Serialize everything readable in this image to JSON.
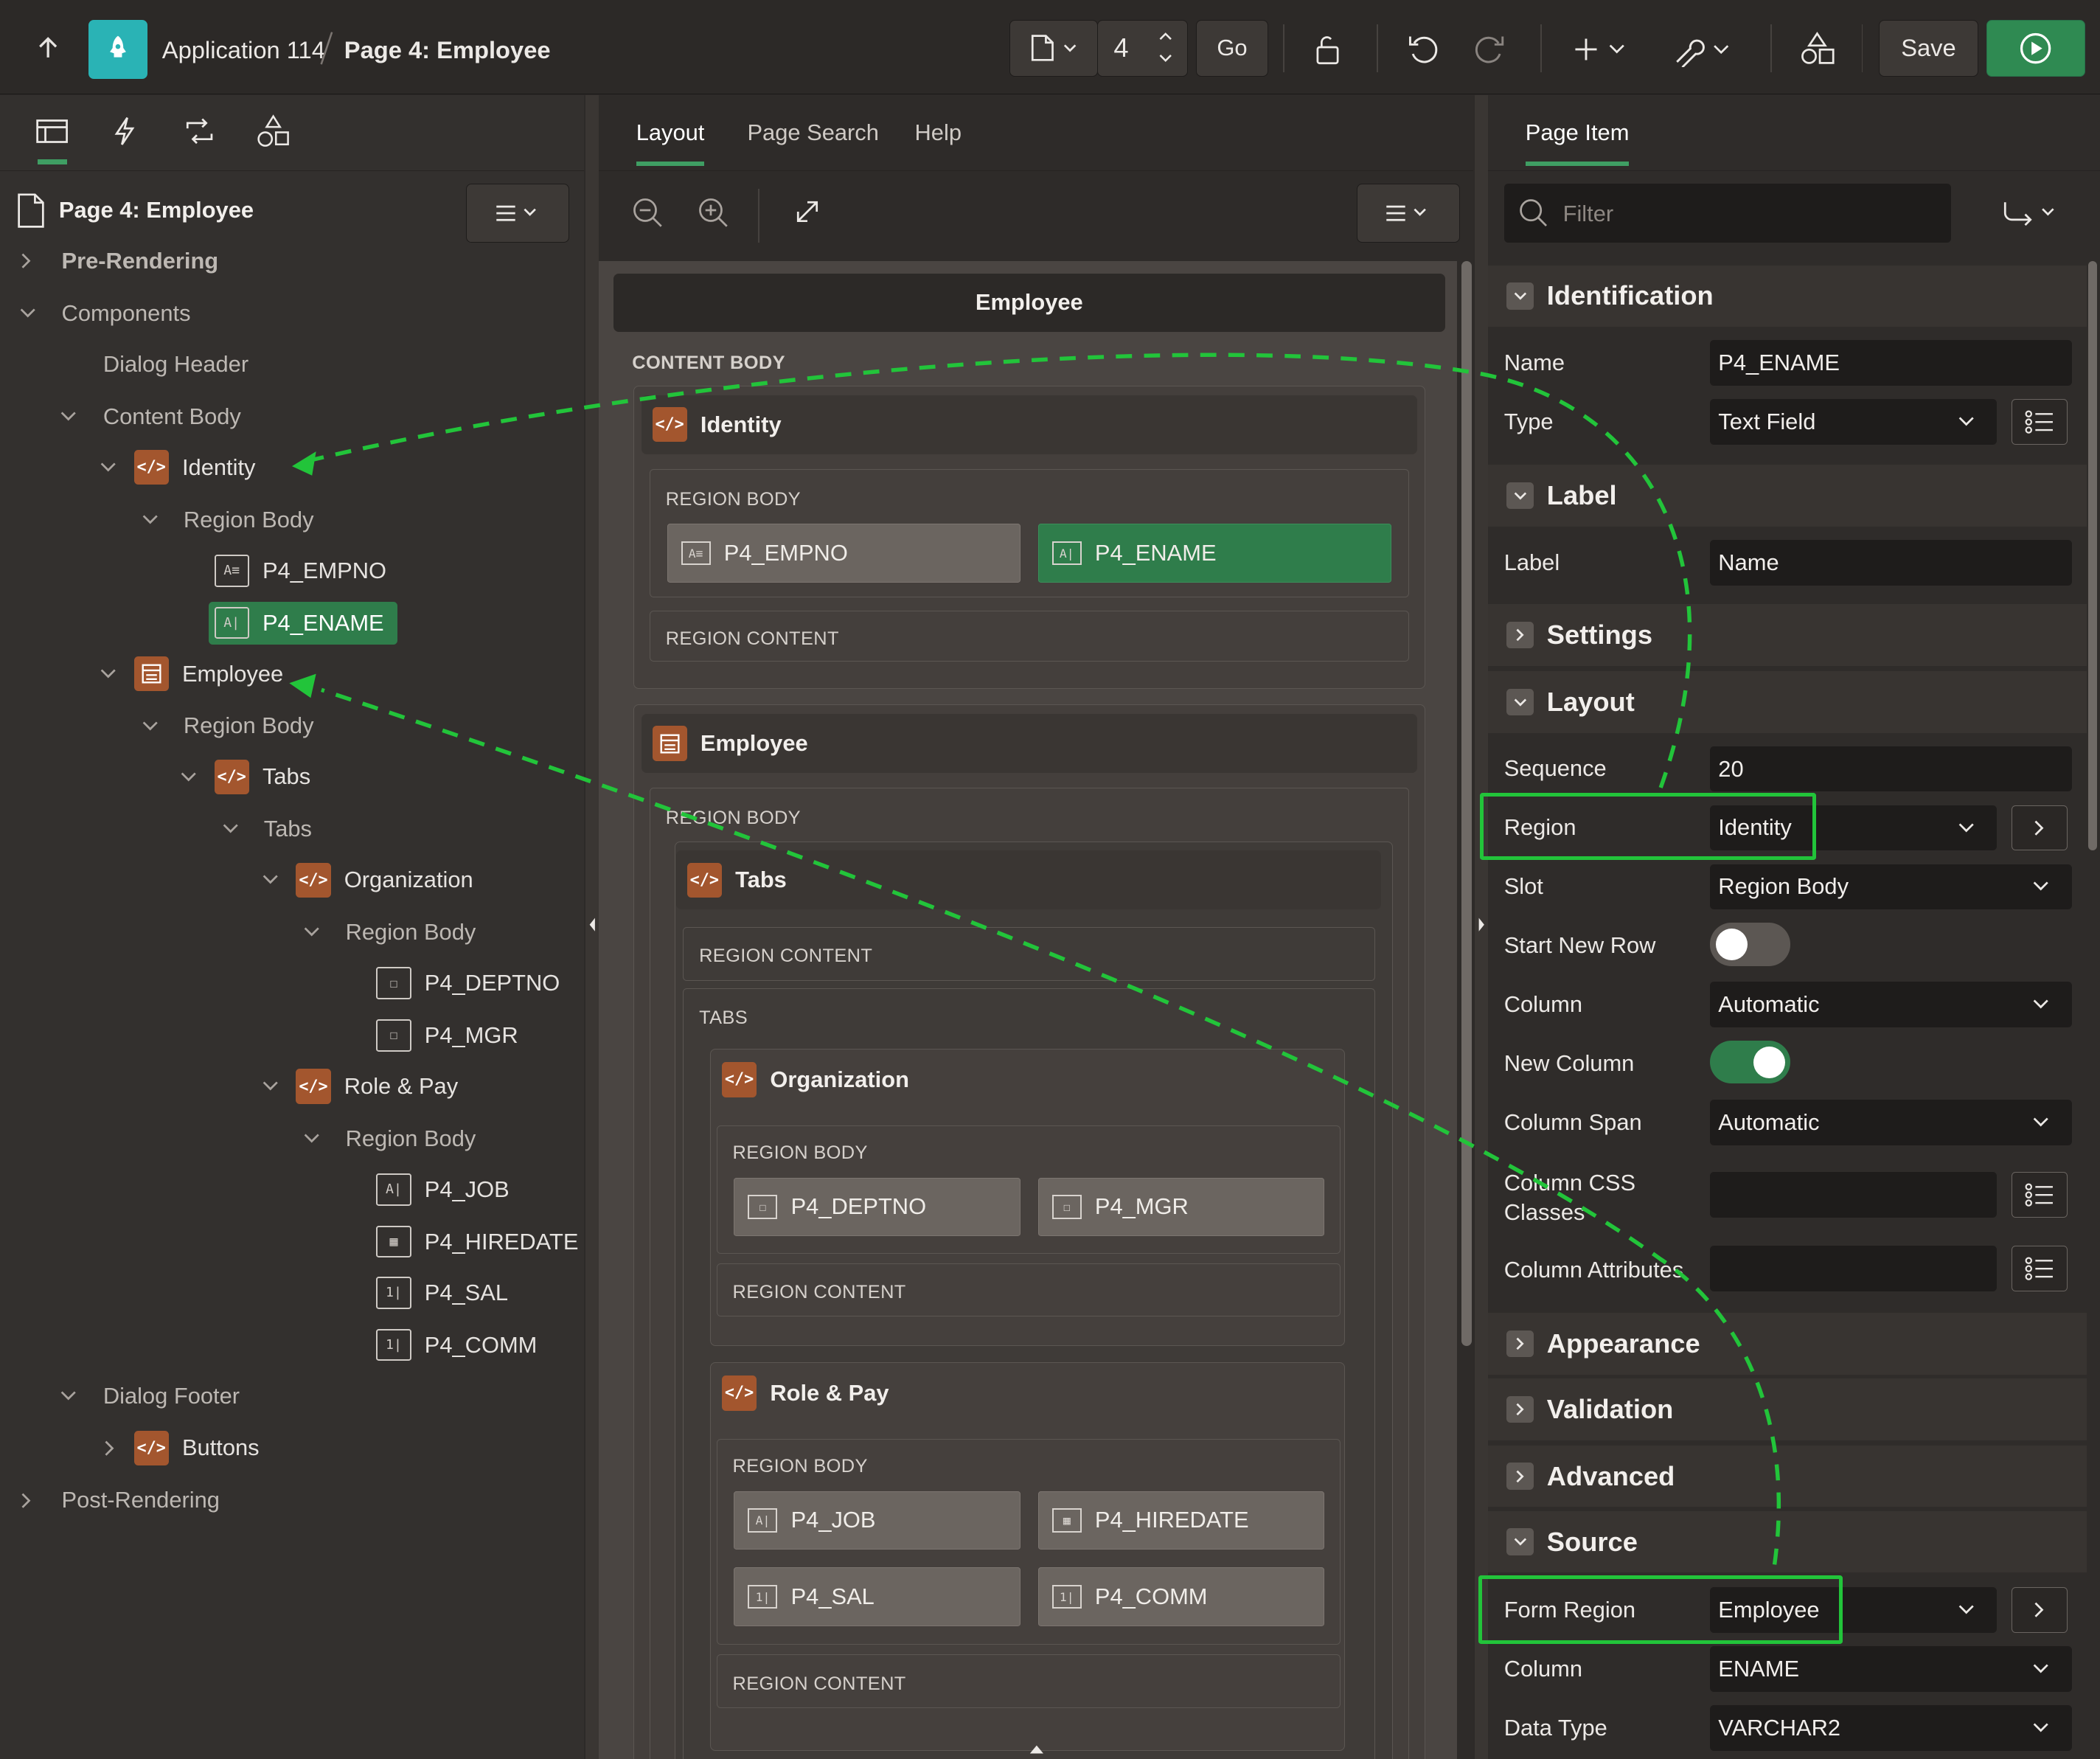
{
  "topbar": {
    "app_name": "Application 114",
    "page_name": "Page 4: Employee",
    "page_number": "4",
    "go_label": "Go",
    "save_label": "Save"
  },
  "left": {
    "page_title": "Page 4: Employee",
    "tree": {
      "pre_rendering": "Pre-Rendering",
      "components": "Components",
      "dialog_header": "Dialog Header",
      "content_body": "Content Body",
      "identity": "Identity",
      "region_body": "Region Body",
      "p4_empno": "P4_EMPNO",
      "p4_ename": "P4_ENAME",
      "employee": "Employee",
      "tabs": "Tabs",
      "organization": "Organization",
      "p4_deptno": "P4_DEPTNO",
      "p4_mgr": "P4_MGR",
      "role_pay": "Role & Pay",
      "p4_job": "P4_JOB",
      "p4_hiredate": "P4_HIREDATE",
      "p4_sal": "P4_SAL",
      "p4_comm": "P4_COMM",
      "dialog_footer": "Dialog Footer",
      "buttons": "Buttons",
      "post_rendering": "Post-Rendering"
    }
  },
  "center": {
    "tabs": [
      "Layout",
      "Page Search",
      "Help"
    ],
    "page_header": "Employee",
    "content_body": "CONTENT BODY",
    "region_body": "REGION BODY",
    "region_content": "REGION CONTENT",
    "tabs_slot": "TABS",
    "identity": "Identity",
    "employee": "Employee",
    "tabs_region": "Tabs",
    "organization": "Organization",
    "role_pay": "Role & Pay",
    "items": {
      "empno": "P4_EMPNO",
      "ename": "P4_ENAME",
      "deptno": "P4_DEPTNO",
      "mgr": "P4_MGR",
      "job": "P4_JOB",
      "hiredate": "P4_HIREDATE",
      "sal": "P4_SAL",
      "comm": "P4_COMM"
    }
  },
  "right": {
    "tab": "Page Item",
    "filter_placeholder": "Filter",
    "groups": {
      "identification": "Identification",
      "label": "Label",
      "settings": "Settings",
      "layout": "Layout",
      "appearance": "Appearance",
      "validation": "Validation",
      "advanced": "Advanced",
      "source": "Source"
    },
    "props": {
      "name_label": "Name",
      "name_value": "P4_ENAME",
      "type_label": "Type",
      "type_value": "Text Field",
      "label_label": "Label",
      "label_value": "Name",
      "sequence_label": "Sequence",
      "sequence_value": "20",
      "region_label": "Region",
      "region_value": "Identity",
      "slot_label": "Slot",
      "slot_value": "Region Body",
      "start_new_row_label": "Start New Row",
      "column_label": "Column",
      "column_value": "Automatic",
      "new_column_label": "New Column",
      "column_span_label": "Column Span",
      "column_span_value": "Automatic",
      "column_css_label": "Column CSS Classes",
      "column_attr_label": "Column Attributes",
      "form_region_label": "Form Region",
      "form_region_value": "Employee",
      "src_column_label": "Column",
      "src_column_value": "ENAME",
      "data_type_label": "Data Type",
      "data_type_value": "VARCHAR2"
    },
    "toggles": {
      "start_new_row": false,
      "new_column": true
    }
  },
  "colors": {
    "accent_green": "#2f7d4b",
    "highlight": "#22c43a",
    "region_icon": "#a3562e",
    "app_icon": "#2ab3b5"
  }
}
